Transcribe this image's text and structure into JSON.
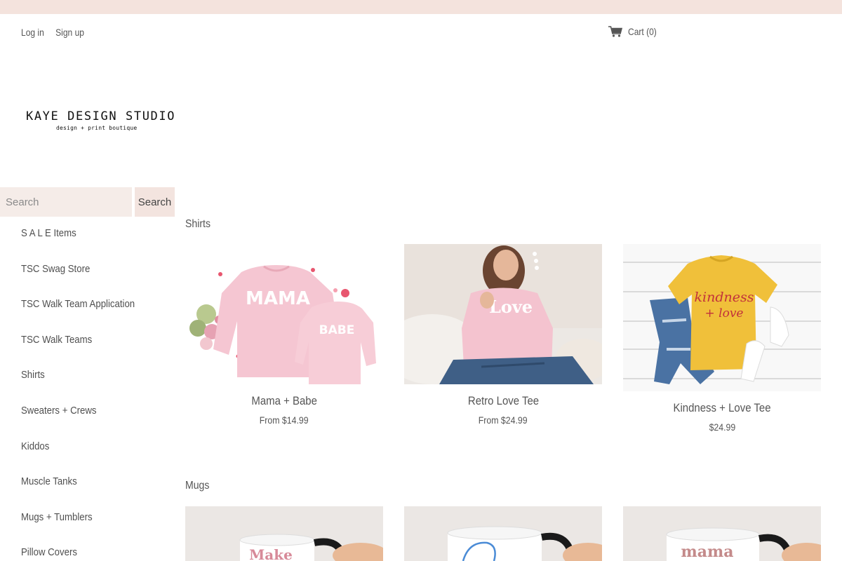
{
  "header": {
    "login_label": "Log in",
    "signup_label": "Sign up",
    "cart_label": "Cart",
    "cart_count": "(0)",
    "cart_icon": "cart-icon"
  },
  "logo": {
    "name": "KAYE DESIGN STUDIO",
    "tagline": "design + print boutique"
  },
  "search": {
    "placeholder": "Search",
    "button_label": "Search"
  },
  "sidebar": {
    "items": [
      {
        "label": "S A L E Items"
      },
      {
        "label": "TSC Swag Store"
      },
      {
        "label": "TSC Walk Team Application"
      },
      {
        "label": "TSC Walk Teams"
      },
      {
        "label": "Shirts"
      },
      {
        "label": "Sweaters + Crews"
      },
      {
        "label": "Kiddos"
      },
      {
        "label": "Muscle Tanks"
      },
      {
        "label": "Mugs + Tumblers"
      },
      {
        "label": "Pillow Covers"
      }
    ]
  },
  "sections": {
    "shirts": {
      "title": "Shirts",
      "products": [
        {
          "title": "Mama + Babe",
          "price": "From $14.99",
          "print_1": "MAMA",
          "print_2": "BABE"
        },
        {
          "title": "Retro Love Tee",
          "price": "From $24.99",
          "print": "Love"
        },
        {
          "title": "Kindness + Love Tee",
          "price": "$24.99",
          "print_1": "kindness",
          "print_2": "+ love"
        }
      ]
    },
    "mugs": {
      "title": "Mugs",
      "products": [
        {
          "print": "Make"
        },
        {
          "print": ""
        },
        {
          "print": "mama"
        }
      ]
    }
  },
  "colors": {
    "top_strip": "#f4e3dd",
    "search_bg": "#f5ece8",
    "accent_pink": "#f5c6d2"
  }
}
